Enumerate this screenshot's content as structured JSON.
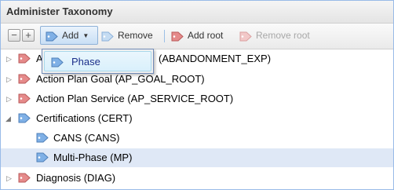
{
  "header": {
    "title": "Administer Taxonomy"
  },
  "toolbar": {
    "collapse_label": "−",
    "expand_label": "+",
    "add_label": "Add",
    "remove_label": "Remove",
    "add_root_label": "Add root",
    "remove_root_label": "Remove root",
    "remove_root_disabled": true
  },
  "add_menu": {
    "items": [
      {
        "label": "Phase"
      }
    ]
  },
  "tree": {
    "rows": [
      {
        "label": "A",
        "label_tail": "(ABANDONMENT_EXP)",
        "expanded": false,
        "level": 0
      },
      {
        "label": "Action Plan Goal (AP_GOAL_ROOT)",
        "expanded": false,
        "level": 0
      },
      {
        "label": "Action Plan Service (AP_SERVICE_ROOT)",
        "expanded": false,
        "level": 0
      },
      {
        "label": "Certifications (CERT)",
        "expanded": true,
        "level": 0
      },
      {
        "label": "CANS (CANS)",
        "level": 1
      },
      {
        "label": "Multi-Phase (MP)",
        "level": 1,
        "selected": true
      },
      {
        "label": "Diagnosis (DIAG)",
        "expanded": false,
        "level": 0
      }
    ]
  },
  "colors": {
    "tag_blue": "#7fb0e6",
    "tag_red": "#e58a8a",
    "selection": "#dfe8f6",
    "menu_text": "#1c2f8a"
  }
}
